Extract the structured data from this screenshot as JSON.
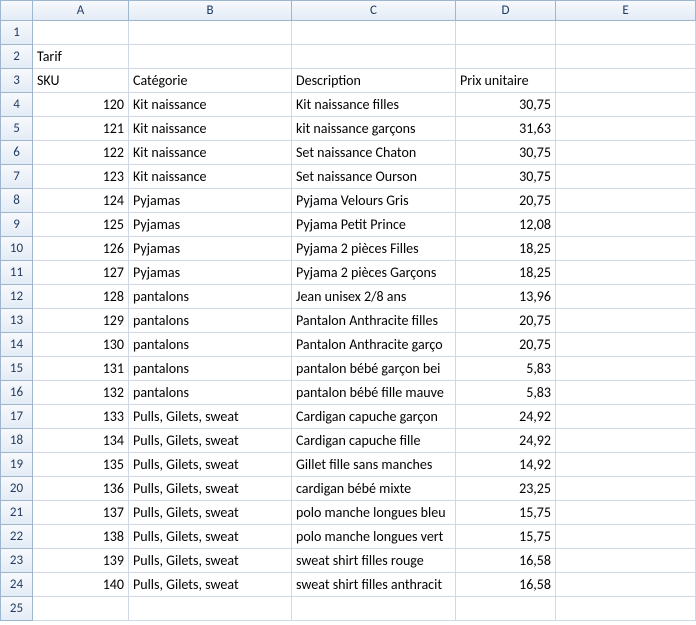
{
  "columns": [
    "A",
    "B",
    "C",
    "D",
    "E"
  ],
  "row_numbers": [
    1,
    2,
    3,
    4,
    5,
    6,
    7,
    8,
    9,
    10,
    11,
    12,
    13,
    14,
    15,
    16,
    17,
    18,
    19,
    20,
    21,
    22,
    23,
    24,
    25
  ],
  "title": "Tarif",
  "headers": {
    "sku": "SKU",
    "cat": "Catégorie",
    "desc": "Description",
    "price": "Prix unitaire"
  },
  "rows": [
    {
      "sku": "120",
      "cat": "Kit naissance",
      "desc": "Kit naissance filles",
      "price": "30,75"
    },
    {
      "sku": "121",
      "cat": "Kit naissance",
      "desc": "kit naissance garçons",
      "price": "31,63"
    },
    {
      "sku": "122",
      "cat": "Kit naissance",
      "desc": "Set naissance Chaton",
      "price": "30,75"
    },
    {
      "sku": "123",
      "cat": "Kit naissance",
      "desc": "Set naissance Ourson",
      "price": "30,75"
    },
    {
      "sku": "124",
      "cat": "Pyjamas",
      "desc": "Pyjama Velours Gris",
      "price": "20,75"
    },
    {
      "sku": "125",
      "cat": "Pyjamas",
      "desc": "Pyjama Petit Prince",
      "price": "12,08"
    },
    {
      "sku": "126",
      "cat": "Pyjamas",
      "desc": "Pyjama 2 pièces Filles",
      "price": "18,25"
    },
    {
      "sku": "127",
      "cat": "Pyjamas",
      "desc": "Pyjama 2 pièces Garçons",
      "price": "18,25"
    },
    {
      "sku": "128",
      "cat": "pantalons",
      "desc": "Jean unisex  2/8 ans",
      "price": "13,96"
    },
    {
      "sku": "129",
      "cat": "pantalons",
      "desc": "Pantalon Anthracite filles",
      "price": "20,75"
    },
    {
      "sku": "130",
      "cat": "pantalons",
      "desc": "Pantalon Anthracite garço",
      "price": "20,75"
    },
    {
      "sku": "131",
      "cat": "pantalons",
      "desc": "pantalon bébé garçon bei",
      "price": "5,83"
    },
    {
      "sku": "132",
      "cat": "pantalons",
      "desc": "pantalon bébé fille mauve",
      "price": "5,83"
    },
    {
      "sku": "133",
      "cat": "Pulls, Gilets, sweat",
      "desc": "Cardigan capuche garçon",
      "price": "24,92"
    },
    {
      "sku": "134",
      "cat": "Pulls, Gilets, sweat",
      "desc": "Cardigan capuche fille",
      "price": "24,92"
    },
    {
      "sku": "135",
      "cat": "Pulls, Gilets, sweat",
      "desc": "Gillet fille sans manches",
      "price": "14,92"
    },
    {
      "sku": "136",
      "cat": "Pulls, Gilets, sweat",
      "desc": "cardigan bébé mixte",
      "price": "23,25"
    },
    {
      "sku": "137",
      "cat": "Pulls, Gilets, sweat",
      "desc": "polo manche longues bleu",
      "price": "15,75"
    },
    {
      "sku": "138",
      "cat": "Pulls, Gilets, sweat",
      "desc": "polo manche longues vert",
      "price": "15,75"
    },
    {
      "sku": "139",
      "cat": "Pulls, Gilets, sweat",
      "desc": "sweat shirt filles rouge",
      "price": "16,58"
    },
    {
      "sku": "140",
      "cat": "Pulls, Gilets, sweat",
      "desc": "sweat shirt filles anthracit",
      "price": "16,58"
    }
  ]
}
